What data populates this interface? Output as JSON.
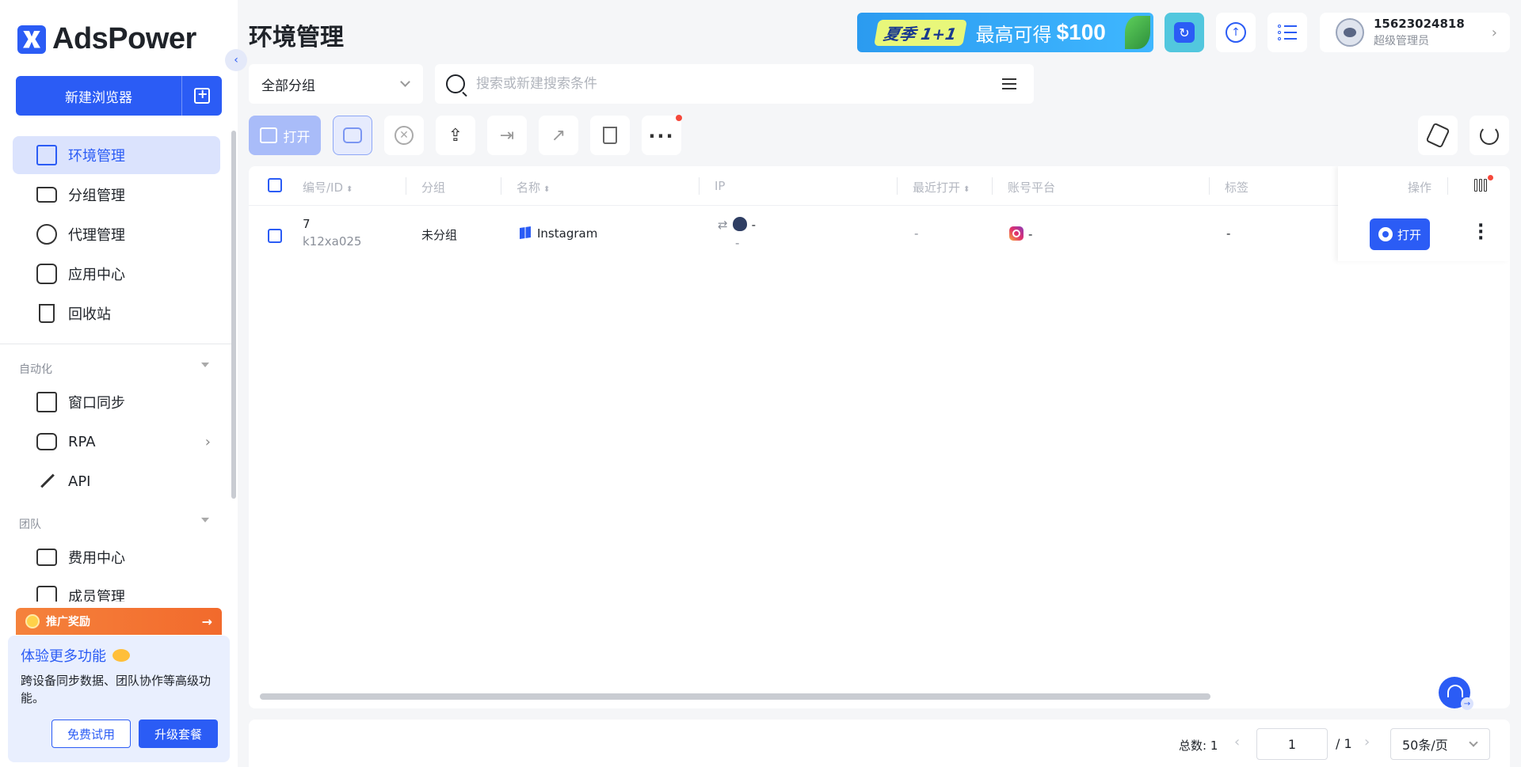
{
  "app": {
    "logo_text": "AdsPower"
  },
  "sidebar": {
    "new_browser_label": "新建浏览器",
    "nav_primary": [
      {
        "label": "环境管理",
        "icon": "browser-window-icon",
        "active": true
      },
      {
        "label": "分组管理",
        "icon": "folder-icon"
      },
      {
        "label": "代理管理",
        "icon": "proxy-icon"
      },
      {
        "label": "应用中心",
        "icon": "puzzle-icon"
      },
      {
        "label": "回收站",
        "icon": "trash-icon"
      }
    ],
    "section_automation": "自动化",
    "nav_automation": [
      {
        "label": "窗口同步",
        "icon": "window-sync-icon"
      },
      {
        "label": "RPA",
        "icon": "robot-icon"
      },
      {
        "label": "API",
        "icon": "plug-icon"
      }
    ],
    "section_team": "团队",
    "nav_team": [
      {
        "label": "费用中心",
        "icon": "wallet-icon"
      },
      {
        "label": "成员管理",
        "icon": "members-icon"
      }
    ],
    "promo_label": "推广奖励",
    "trial": {
      "title": "体验更多功能",
      "desc": "跨设备同步数据、团队协作等高级功能。",
      "free_trial": "免费试用",
      "upgrade": "升级套餐"
    }
  },
  "header": {
    "title": "环境管理",
    "banner": {
      "badge": "夏季 1+1",
      "text": "最高可得",
      "amount": "$100"
    },
    "user": {
      "phone": "15623024818",
      "role": "超级管理员"
    }
  },
  "filters": {
    "group_value": "全部分组",
    "search_placeholder": "搜索或新建搜索条件"
  },
  "toolbar": {
    "open_label": "打开"
  },
  "table": {
    "columns": {
      "id": "编号/ID",
      "group": "分组",
      "name": "名称",
      "ip": "IP",
      "last_open": "最近打开",
      "platform": "账号平台",
      "tags": "标签",
      "action": "操作"
    },
    "rows": [
      {
        "num": "7",
        "id": "k12xa025",
        "group": "未分组",
        "name": "Instagram",
        "ip_main": "-",
        "ip_sub": "-",
        "last_open": "-",
        "platform": "-",
        "tags": "-",
        "open_label": "打开"
      }
    ]
  },
  "pager": {
    "total": "总数: 1",
    "page": "1",
    "of": "/ 1",
    "size": "50条/页"
  },
  "colors": {
    "accent": "#2b5cf5",
    "accent_light": "#dbe3fd",
    "promo": "#f26a2c"
  }
}
